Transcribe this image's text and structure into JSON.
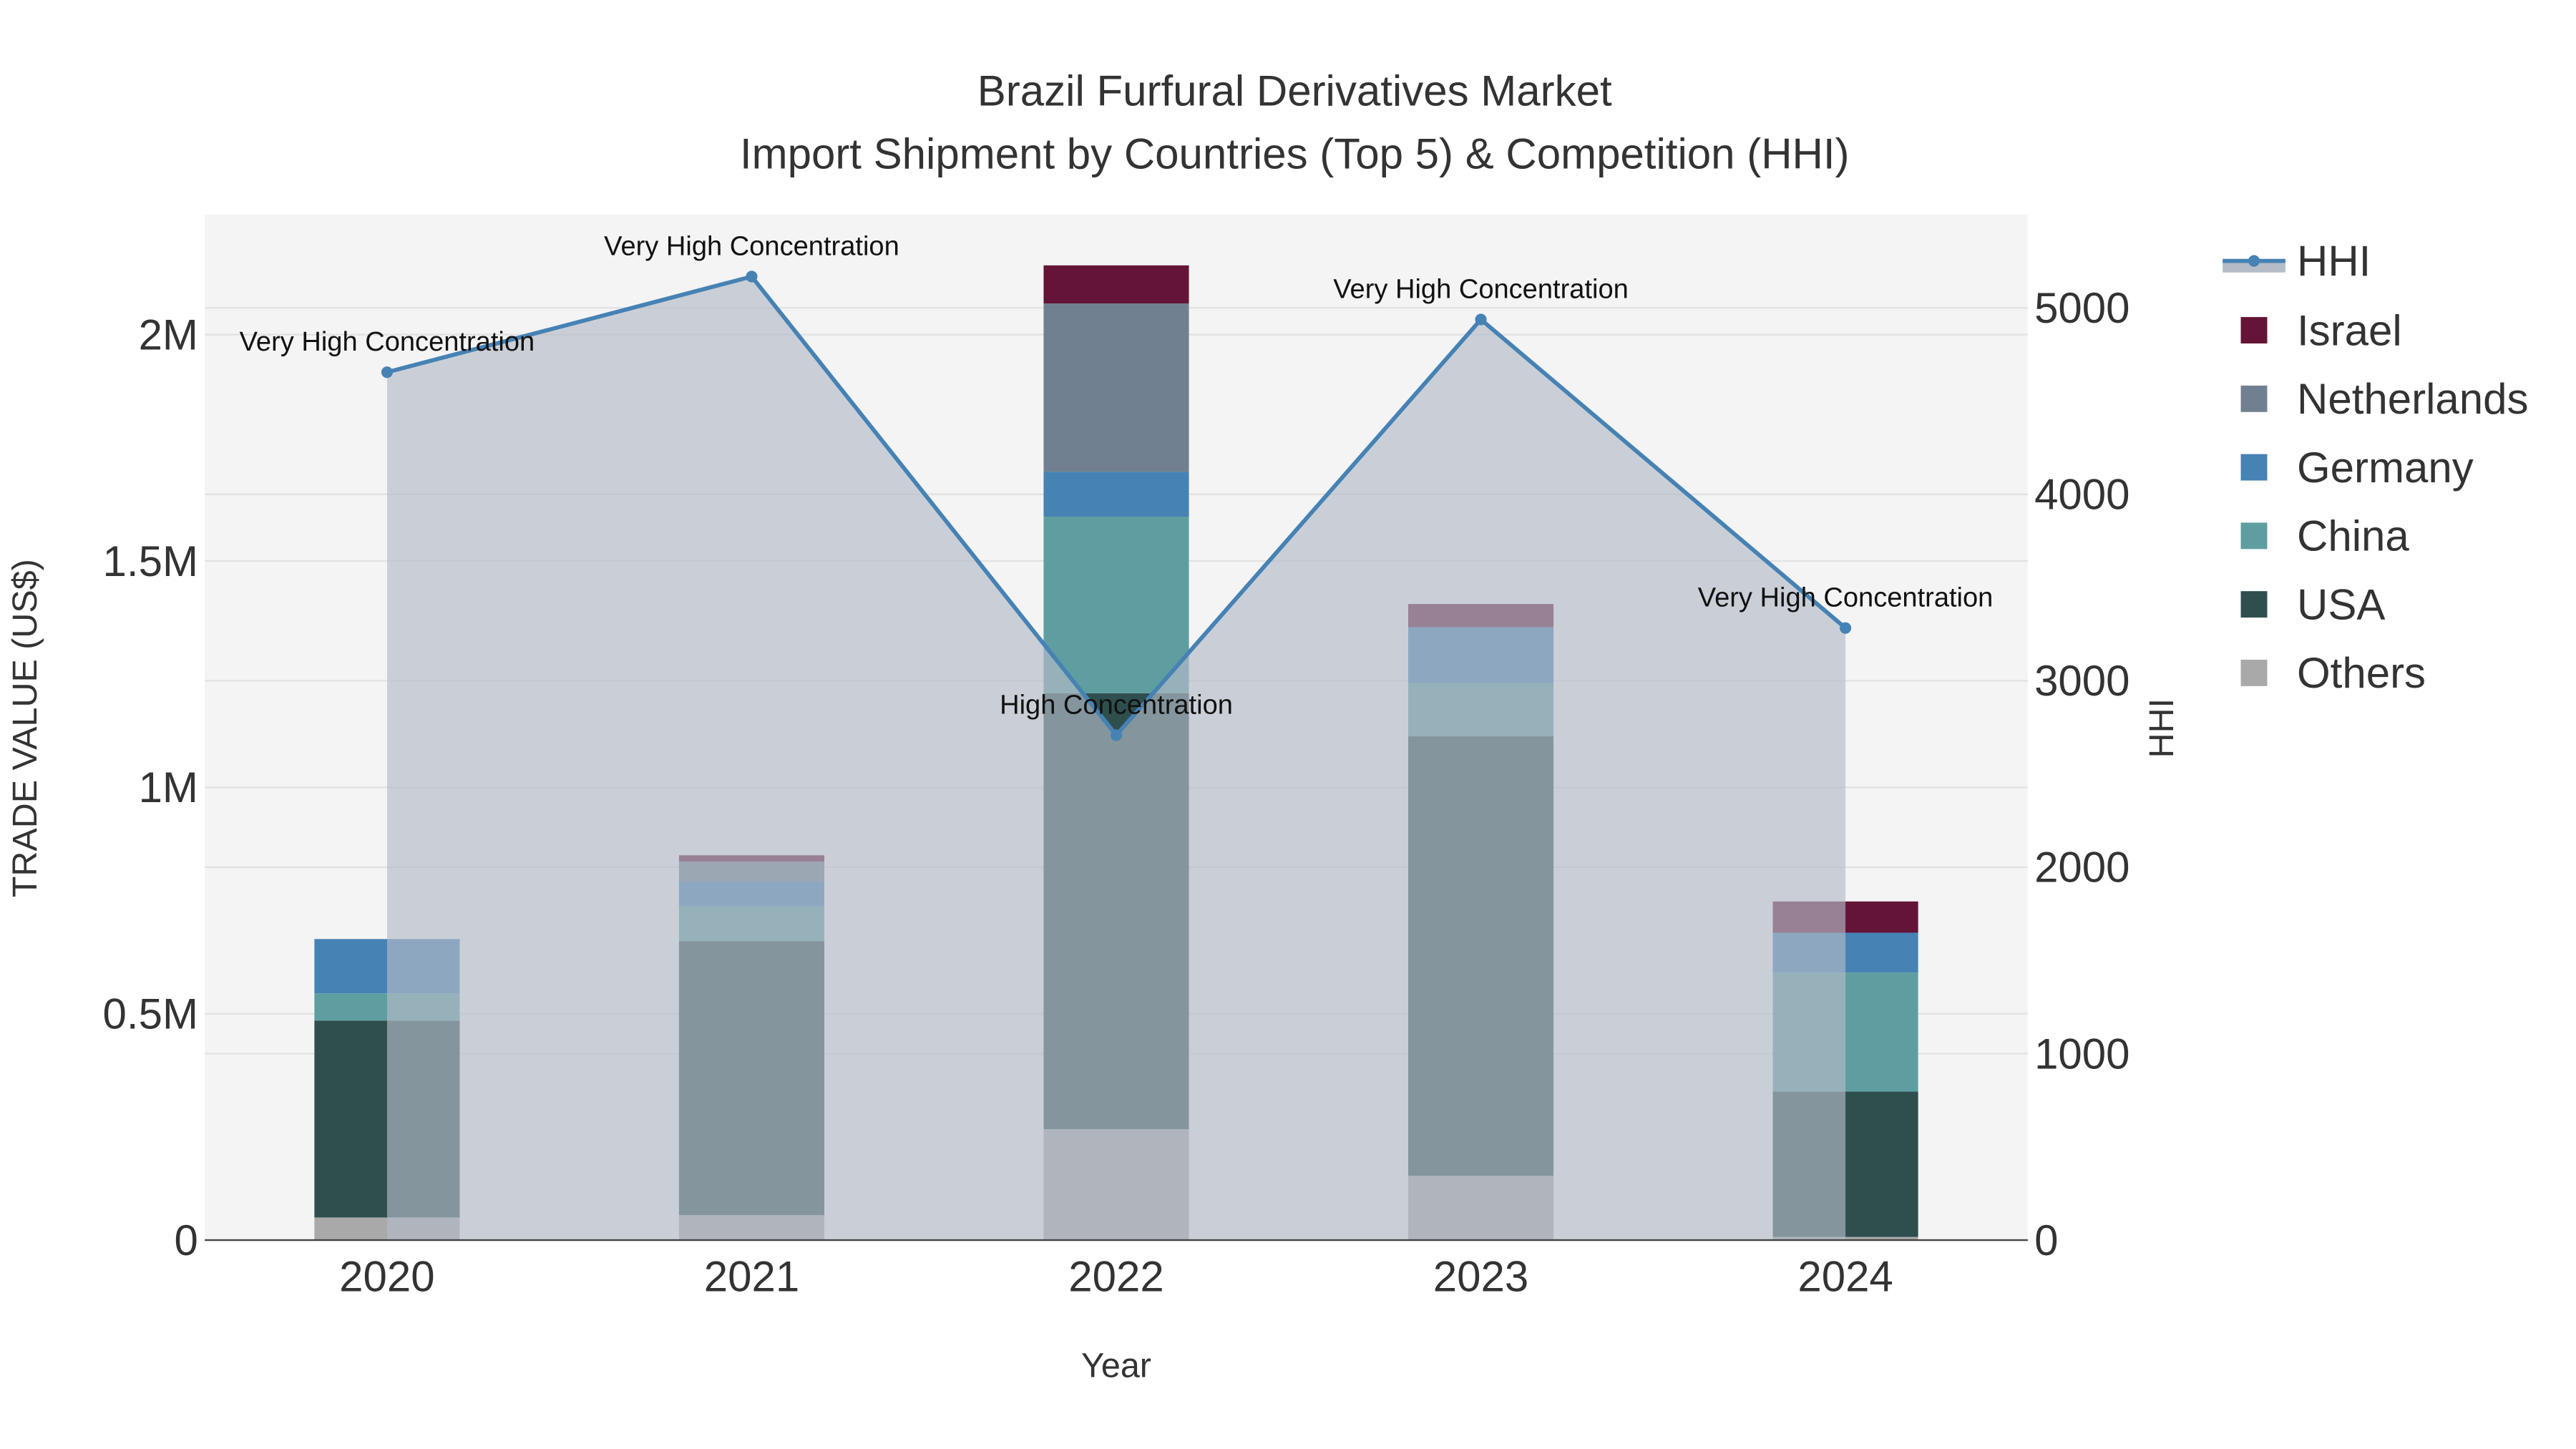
{
  "chart_data": {
    "type": "bar",
    "title": "Brazil Furfural Derivatives Market",
    "subtitle": "Import Shipment by Countries (Top 5) & Competition (HHI)",
    "xlabel": "Year",
    "ylabel": "TRADE VALUE (US$)",
    "y2label": "HHI",
    "categories": [
      "2020",
      "2021",
      "2022",
      "2023",
      "2024"
    ],
    "ylim": [
      0,
      2265000
    ],
    "y2lim": [
      0,
      5500
    ],
    "yticks": [
      0,
      500000,
      1000000,
      1500000,
      2000000
    ],
    "ytick_labels": [
      "0",
      "0.5M",
      "1M",
      "1.5M",
      "2M"
    ],
    "y2ticks": [
      0,
      1000,
      2000,
      3000,
      4000,
      5000
    ],
    "y2tick_labels": [
      "0",
      "1000",
      "2000",
      "3000",
      "4000",
      "5000"
    ],
    "grid": true,
    "legend_position": "right",
    "series": [
      {
        "name": "Others",
        "color": "#a9a9a9",
        "values": [
          50000,
          55000,
          245000,
          142000,
          7000
        ]
      },
      {
        "name": "USA",
        "color": "#2f4f4f",
        "values": [
          435000,
          605000,
          963000,
          971000,
          321000
        ]
      },
      {
        "name": "China",
        "color": "#5f9ea0",
        "values": [
          60000,
          77000,
          390000,
          117000,
          263000
        ]
      },
      {
        "name": "Germany",
        "color": "#4682b4",
        "values": [
          120000,
          55000,
          99000,
          124000,
          88000
        ]
      },
      {
        "name": "Netherlands",
        "color": "#708090",
        "values": [
          0,
          44000,
          372000,
          0,
          0
        ]
      },
      {
        "name": "Israel",
        "color": "#641436",
        "values": [
          0,
          14000,
          84000,
          51000,
          69000
        ]
      }
    ],
    "hhi": {
      "name": "HHI",
      "color": "#4682b4",
      "values": [
        4655,
        5168,
        2708,
        4938,
        3283
      ],
      "annotations": [
        "Very High Concentration",
        "Very High Concentration",
        "High Concentration",
        "Very High Concentration",
        "Very High Concentration"
      ]
    },
    "legend": [
      "HHI",
      "Israel",
      "Netherlands",
      "Germany",
      "China",
      "USA",
      "Others"
    ]
  }
}
